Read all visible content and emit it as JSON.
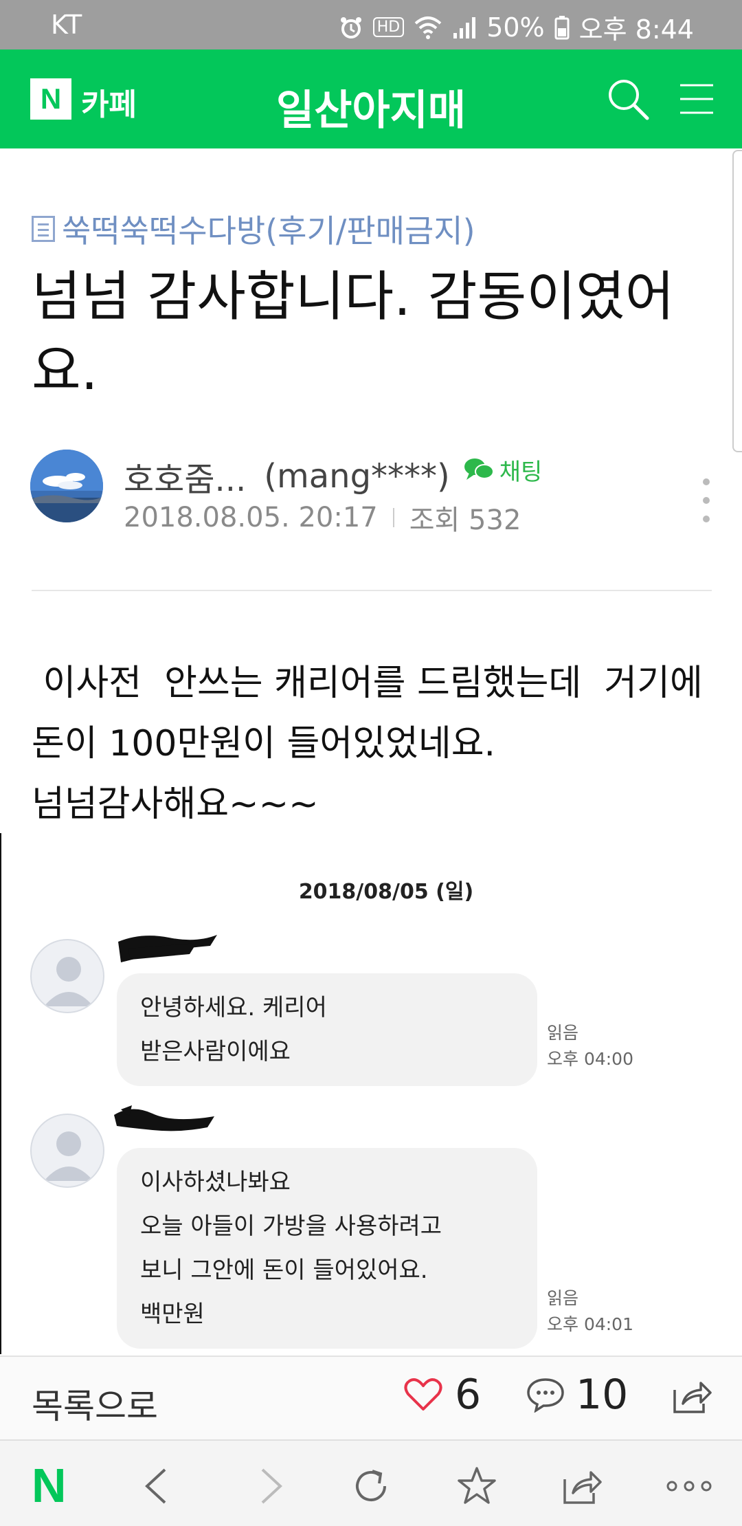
{
  "status_bar": {
    "carrier": "KT",
    "hd_label": "HD",
    "battery": "50%",
    "time": "오후 8:44"
  },
  "header": {
    "logo_letter": "N",
    "logo_text": "카페",
    "cafe_name": "일산아지매"
  },
  "article": {
    "board_name": "쑥떡쑥떡수다방(후기/판매금지)",
    "title": "넘넘 감사합니다. 감동이였어요.",
    "author_nick": "호호줌...",
    "author_id": "(mang****)",
    "chat_label": "채팅",
    "date": "2018.08.05. 20:17",
    "views": "조회 532",
    "body": " 이사전  안쓰는 캐리어를 드림했는데  거기에 돈이 100만원이 들어있었네요.\n넘넘감사해요~~~"
  },
  "chat_screenshot": {
    "date": "2018/08/05 (일)",
    "messages": [
      {
        "lines": [
          "안녕하세요.  케리어",
          "받은사람이에요"
        ],
        "read": "읽음",
        "time": "오후 04:00"
      },
      {
        "lines": [
          "이사하셨나봐요",
          "오늘 아들이 가방을 사용하려고",
          "보니 그안에 돈이 들어있어요.",
          "백만원"
        ],
        "read": "읽음",
        "time": "오후 04:01"
      }
    ]
  },
  "action_bar": {
    "list_label": "목록으로",
    "likes": "6",
    "comments": "10"
  },
  "colors": {
    "brand_green": "#03c75a",
    "like_red": "#e8334a",
    "board_blue": "#6f8fc2"
  },
  "icons": [
    "search-icon",
    "menu-icon",
    "chat-bubble-icon",
    "more-vertical-icon",
    "heart-icon",
    "comment-icon",
    "share-icon",
    "back-icon",
    "forward-icon",
    "refresh-icon",
    "bookmark-star-icon",
    "more-horizontal-icon"
  ]
}
